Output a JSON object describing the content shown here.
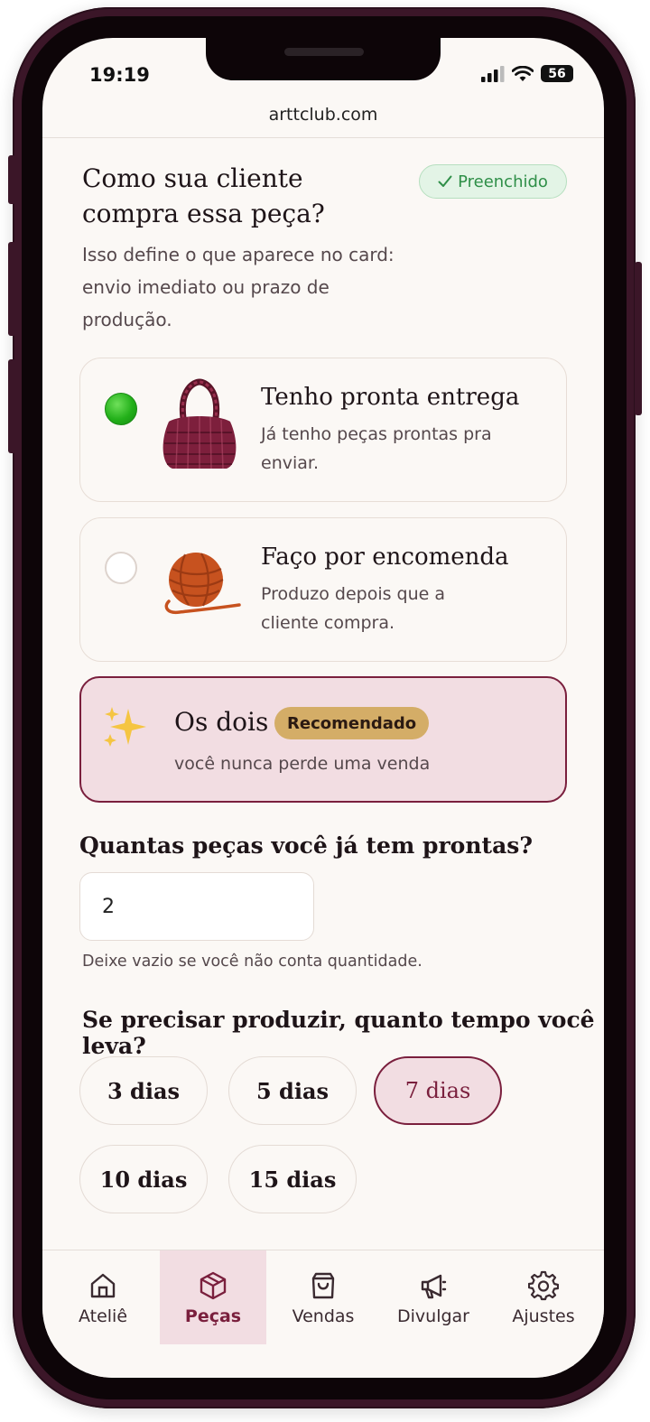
{
  "status_bar": {
    "time": "19:19",
    "battery": "56"
  },
  "browser": {
    "url": "arttclub.com"
  },
  "question": {
    "title": "Como sua cliente compra essa peça?",
    "badge": "Preenchido",
    "description": "Isso define o que aparece no card: envio imediato ou prazo de produção."
  },
  "options": [
    {
      "title": "Tenho pronta entrega",
      "subtitle": "Já tenho peças prontas pra enviar.",
      "selected": true
    },
    {
      "title": "Faço por encomenda",
      "subtitle": "Produzo depois que a cliente compra.",
      "selected": false
    },
    {
      "title": "Os dois",
      "badge": "Recomendado",
      "subtitle": "você nunca perde uma venda"
    }
  ],
  "quantity": {
    "label": "Quantas peças você já tem prontas?",
    "value": "2",
    "hint": "Deixe vazio se você não conta quantidade."
  },
  "production": {
    "label": "Se precisar produzir, quanto tempo você leva?",
    "chips": [
      "3 dias",
      "5 dias",
      "7 dias",
      "10 dias",
      "15 dias"
    ],
    "selected": "7 dias"
  },
  "tabbar": {
    "tabs": [
      {
        "label": "Ateliê",
        "icon": "home-icon"
      },
      {
        "label": "Peças",
        "icon": "box-icon"
      },
      {
        "label": "Vendas",
        "icon": "shopping-bag-icon"
      },
      {
        "label": "Divulgar",
        "icon": "megaphone-icon"
      },
      {
        "label": "Ajustes",
        "icon": "gear-icon"
      }
    ],
    "active": "Peças"
  },
  "colors": {
    "accent": "#7a1f3d",
    "accent_bg": "#f2dde2",
    "success": "#2f8f48",
    "highlight_badge": "#d4ad67",
    "screen_bg": "#fbf8f5"
  }
}
